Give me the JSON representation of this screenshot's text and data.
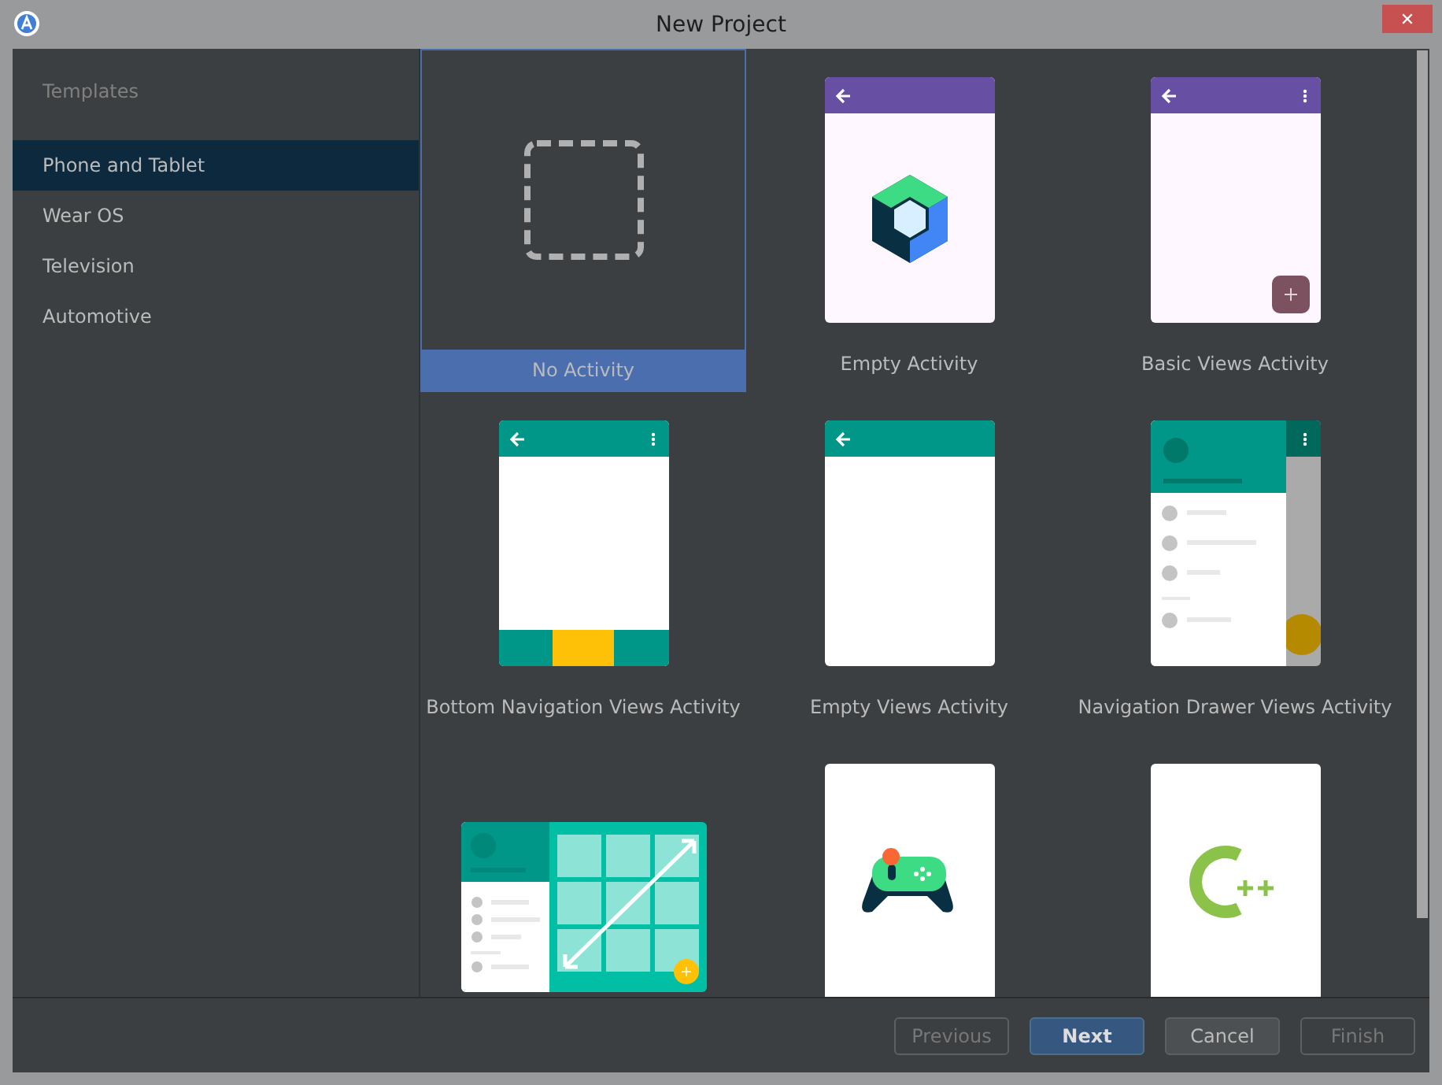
{
  "window": {
    "title": "New Project",
    "close": "✕"
  },
  "sidebar": {
    "heading": "Templates",
    "items": [
      {
        "label": "Phone and Tablet",
        "selected": true
      },
      {
        "label": "Wear OS",
        "selected": false
      },
      {
        "label": "Television",
        "selected": false
      },
      {
        "label": "Automotive",
        "selected": false
      }
    ]
  },
  "templates": [
    {
      "kind": "none",
      "label": "No Activity",
      "selected": true
    },
    {
      "kind": "compose",
      "label": "Empty Activity",
      "selected": false
    },
    {
      "kind": "basic",
      "label": "Basic Views Activity",
      "selected": false
    },
    {
      "kind": "bottomnav",
      "label": "Bottom Navigation Views Activity",
      "selected": false
    },
    {
      "kind": "emptyviews",
      "label": "Empty Views Activity",
      "selected": false
    },
    {
      "kind": "drawer",
      "label": "Navigation Drawer Views Activity",
      "selected": false
    },
    {
      "kind": "responsive",
      "selected": false
    },
    {
      "kind": "game",
      "selected": false
    },
    {
      "kind": "cpp",
      "selected": false
    }
  ],
  "buttons": [
    {
      "label": "Previous",
      "disabled": true,
      "default": false
    },
    {
      "label": "Next",
      "disabled": false,
      "default": true
    },
    {
      "label": "Cancel",
      "disabled": false,
      "default": false
    },
    {
      "label": "Finish",
      "disabled": true,
      "default": false
    }
  ]
}
